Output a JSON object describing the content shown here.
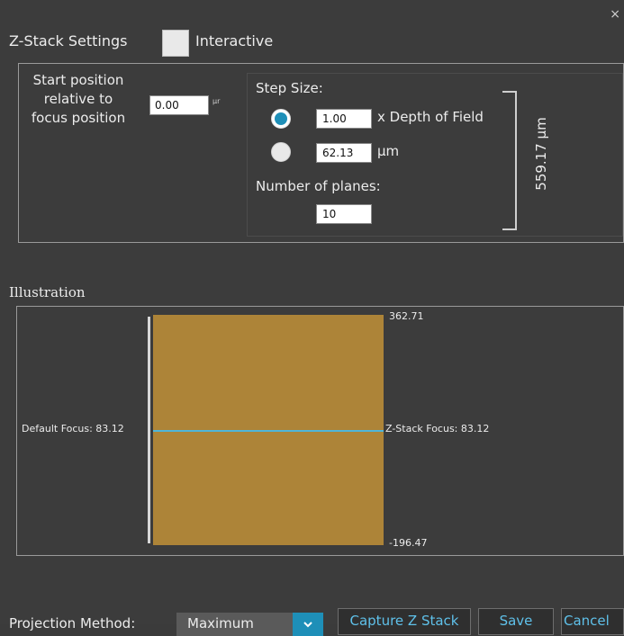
{
  "dialog": {
    "close_glyph": "×",
    "title": "Z-Stack Settings",
    "interactive_label": "Interactive",
    "interactive_checked": false
  },
  "start_position": {
    "label": "Start position relative to focus position",
    "value": "0.00",
    "unit": "µr"
  },
  "step_size": {
    "title": "Step Size:",
    "dof_value": "1.00",
    "dof_label": "x Depth of Field",
    "dof_selected": true,
    "um_value": "62.13",
    "um_label": "µm",
    "um_selected": false
  },
  "planes": {
    "title": "Number of planes:",
    "value": "10"
  },
  "total_range": {
    "label": "559.17 µm"
  },
  "illustration": {
    "title": "Illustration",
    "top_value": "362.71",
    "bottom_value": "-196.47",
    "default_focus": "Default Focus: 83.12",
    "zstack_focus": "Z-Stack Focus: 83.12",
    "bar_color": "#ad8438",
    "focus_line_color": "#4fb6d8"
  },
  "footer": {
    "projection_label": "Projection Method:",
    "projection_value": "Maximum",
    "capture_label": "Capture Z Stack",
    "save_label": "Save",
    "cancel_label": "Cancel"
  },
  "colors": {
    "accent": "#1e8fb8",
    "link_text": "#5fc1ea",
    "background": "#3c3c3c"
  }
}
